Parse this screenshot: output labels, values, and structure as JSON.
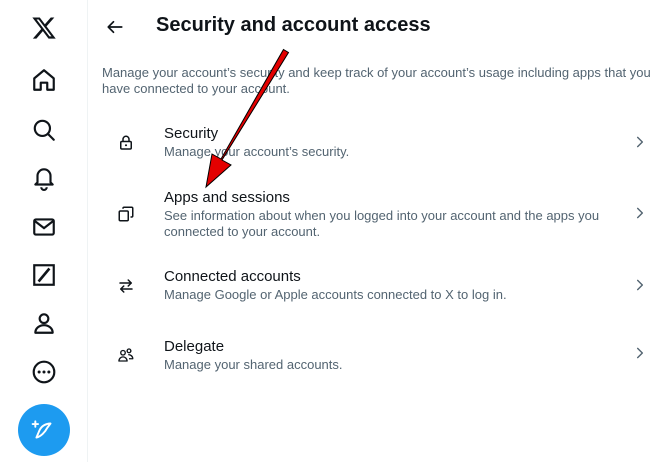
{
  "header": {
    "title": "Security and account access",
    "back_icon": "arrow-left-icon"
  },
  "description": "Manage your account’s security and keep track of your account’s usage including apps that you have connected to your account.",
  "rail": {
    "items": [
      {
        "name": "x-logo-icon"
      },
      {
        "name": "home-icon"
      },
      {
        "name": "search-icon"
      },
      {
        "name": "notifications-icon"
      },
      {
        "name": "messages-icon"
      },
      {
        "name": "grok-icon"
      },
      {
        "name": "profile-icon"
      },
      {
        "name": "more-icon"
      }
    ],
    "post_button_icon": "compose-post-icon",
    "post_button_color": "#1d9bf0"
  },
  "settings": [
    {
      "title": "Security",
      "subtitle": "Manage your account’s security.",
      "icon": "lock-icon"
    },
    {
      "title": "Apps and sessions",
      "subtitle": "See information about when you logged into your account and the apps you connected to your account.",
      "icon": "apps-icon"
    },
    {
      "title": "Connected accounts",
      "subtitle": "Manage Google or Apple accounts connected to X to log in.",
      "icon": "arrows-swap-icon"
    },
    {
      "title": "Delegate",
      "subtitle": "Manage your shared accounts.",
      "icon": "people-icon"
    }
  ],
  "colors": {
    "text_primary": "#0f1419",
    "text_secondary": "#536471",
    "annotation_arrow": "#e30000"
  }
}
